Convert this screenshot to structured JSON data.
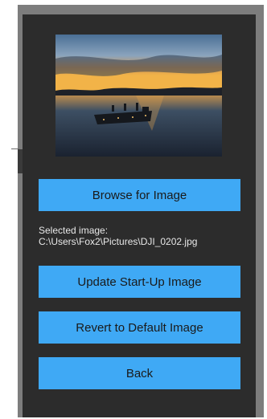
{
  "preview": {
    "image": "startup-image-preview"
  },
  "buttons": {
    "browse_label": "Browse for Image",
    "update_label": "Update Start-Up Image",
    "revert_label": "Revert to Default Image",
    "back_label": "Back"
  },
  "selection": {
    "label": "Selected image:",
    "path": "C:\\Users\\Fox2\\Pictures\\DJI_0202.jpg"
  },
  "colors": {
    "panel_bg": "#2c2c2c",
    "button_bg": "#3fa9f5",
    "frame": "#7d7d7d"
  }
}
